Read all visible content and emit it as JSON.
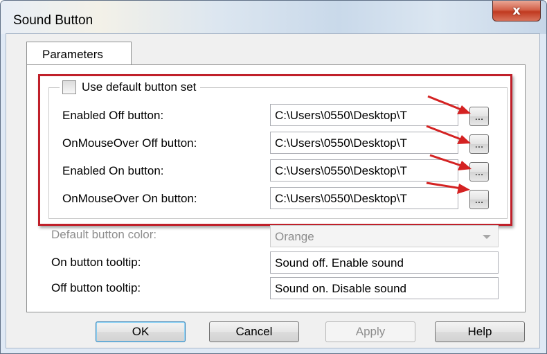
{
  "window": {
    "title": "Sound Button",
    "close_glyph": "x"
  },
  "tabs": [
    {
      "label": "Parameters"
    }
  ],
  "group": {
    "checkbox_label": "Use default button set",
    "checkbox_checked": false,
    "rows": [
      {
        "label": "Enabled Off button:",
        "value": "C:\\Users\\0550\\Desktop\\T",
        "browse_label": "..."
      },
      {
        "label": "OnMouseOver Off button:",
        "value": "C:\\Users\\0550\\Desktop\\T",
        "browse_label": "..."
      },
      {
        "label": "Enabled On button:",
        "value": "C:\\Users\\0550\\Desktop\\T",
        "browse_label": "..."
      },
      {
        "label": "OnMouseOver On button:",
        "value": "C:\\Users\\0550\\Desktop\\T",
        "browse_label": "..."
      }
    ]
  },
  "default_color": {
    "label": "Default button color:",
    "value": "Orange",
    "enabled": false
  },
  "on_tooltip": {
    "label": "On button tooltip:",
    "value": "Sound off. Enable sound"
  },
  "off_tooltip": {
    "label": "Off button tooltip:",
    "value": "Sound on. Disable sound"
  },
  "buttons": {
    "ok": "OK",
    "cancel": "Cancel",
    "apply": "Apply",
    "help": "Help"
  },
  "colors": {
    "highlight": "#c0202a",
    "arrow": "#d42222",
    "titlebar": "#dfe9f5"
  },
  "icons": {
    "close": "close-icon",
    "arrow": "annotation-arrow-icon"
  }
}
